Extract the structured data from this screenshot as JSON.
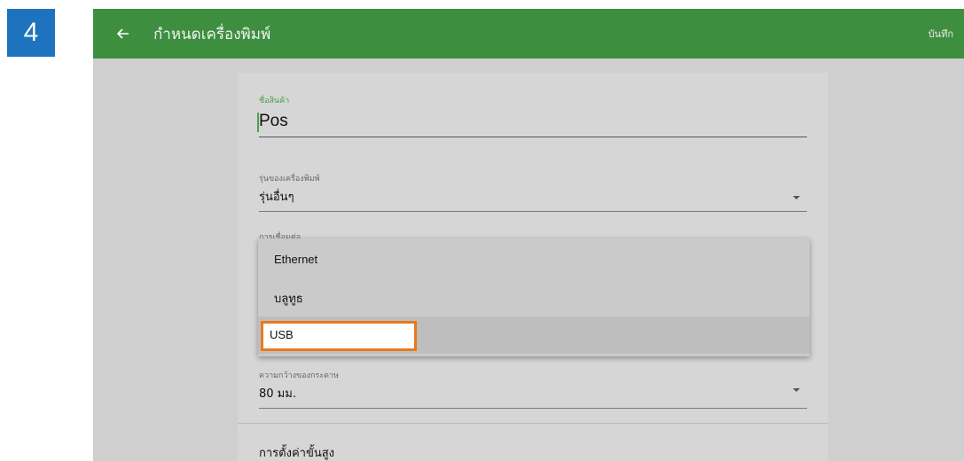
{
  "step": {
    "number": "4"
  },
  "appbar": {
    "title": "กำหนดเครื่องพิมพ์",
    "save_label": "บันทึก"
  },
  "form": {
    "product_name": {
      "label": "ชื่อสินค้า",
      "value": "Pos"
    },
    "printer_model": {
      "label": "รุ่นของเครื่องพิมพ์",
      "value": "รุ่นอื่นๆ"
    },
    "connection": {
      "label": "การเชื่อมต่อ",
      "options": [
        "Ethernet",
        "บลูทูธ",
        "USB"
      ],
      "selected": "USB"
    },
    "paper_width": {
      "label": "ความกว้างของกระดาษ",
      "value": "80 มม."
    },
    "advanced_label": "การตั้งค่าขั้นสูง"
  },
  "colors": {
    "appbar": "#3d8f3f",
    "badge": "#1e73be",
    "highlight": "#e87a1d",
    "label_green": "#48a04a"
  },
  "icons": {
    "back": "arrow-left-icon",
    "dropdown": "triangle-down-icon"
  }
}
